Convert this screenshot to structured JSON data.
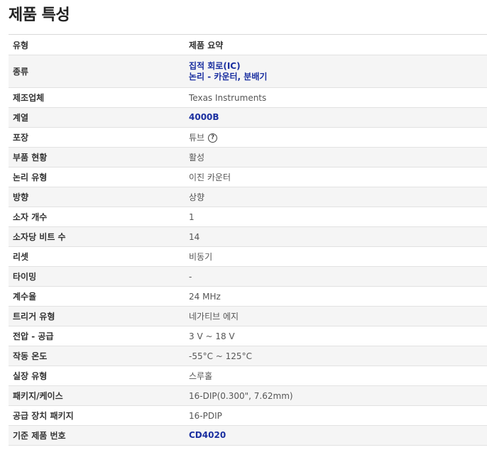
{
  "page_title": "제품 특성",
  "header": {
    "col_type": "유형",
    "col_summary": "제품 요약"
  },
  "rows": [
    {
      "label": "종류",
      "values": [
        "집적 회로(IC)",
        "논리 - 카운터, 분배기"
      ],
      "link": true
    },
    {
      "label": "제조업체",
      "value": "Texas Instruments"
    },
    {
      "label": "계열",
      "value": "4000B",
      "link": true
    },
    {
      "label": "포장",
      "value": "튜브",
      "help_icon": "question-circle-icon",
      "help_glyph": "?"
    },
    {
      "label": "부품 현황",
      "value": "활성"
    },
    {
      "label": "논리 유형",
      "value": "이진 카운터"
    },
    {
      "label": "방향",
      "value": "상향"
    },
    {
      "label": "소자 개수",
      "value": "1"
    },
    {
      "label": "소자당 비트 수",
      "value": "14"
    },
    {
      "label": "리셋",
      "value": "비동기"
    },
    {
      "label": "타이밍",
      "value": "-"
    },
    {
      "label": "계수율",
      "value": "24 MHz"
    },
    {
      "label": "트리거 유형",
      "value": "네가티브 에지"
    },
    {
      "label": "전압 - 공급",
      "value": "3 V ~ 18 V"
    },
    {
      "label": "작동 온도",
      "value": "-55°C ~ 125°C"
    },
    {
      "label": "실장 유형",
      "value": "스루홀"
    },
    {
      "label": "패키지/케이스",
      "value": "16-DIP(0.300\", 7.62mm)"
    },
    {
      "label": "공급 장치 패키지",
      "value": "16-PDIP"
    },
    {
      "label": "기준 제품 번호",
      "value": "CD4020",
      "link": true
    }
  ],
  "colors": {
    "link": "#1a2fa0",
    "stripe": "#f5f5f5",
    "border": "#e2e2e2"
  }
}
